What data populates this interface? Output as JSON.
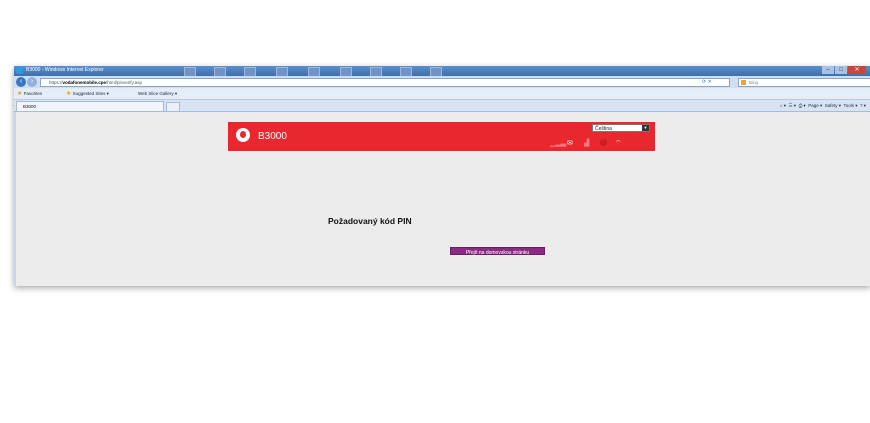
{
  "window": {
    "title": "B3000 - Windows Internet Explorer",
    "controls": [
      "–",
      "□",
      "✕"
    ]
  },
  "address_bar": {
    "url_prefix": "https://",
    "url_host": "vodafonemobile.cpe",
    "url_path": "/html/pinverify.asp",
    "search_placeholder": "Bing"
  },
  "favorites_bar": {
    "favorites": "Favorites",
    "suggested": "Suggested Sites ▾",
    "gallery": "Web Slice Gallery ▾"
  },
  "tab": {
    "label": "B3000"
  },
  "command_bar": {
    "page": "Page ▾",
    "safety": "Safety ▾",
    "tools": "Tools ▾"
  },
  "router": {
    "brand": "B3000",
    "language": "Čeština",
    "pin_label": "Požadovaný kód PIN",
    "home_button": "Přejít na domovskou stránku"
  },
  "colors": {
    "header_red": "#e8282e",
    "button_purple": "#8d2b84"
  },
  "icons": [
    "signal-icon",
    "sms-icon",
    "sim-icon",
    "wifi-icon"
  ]
}
